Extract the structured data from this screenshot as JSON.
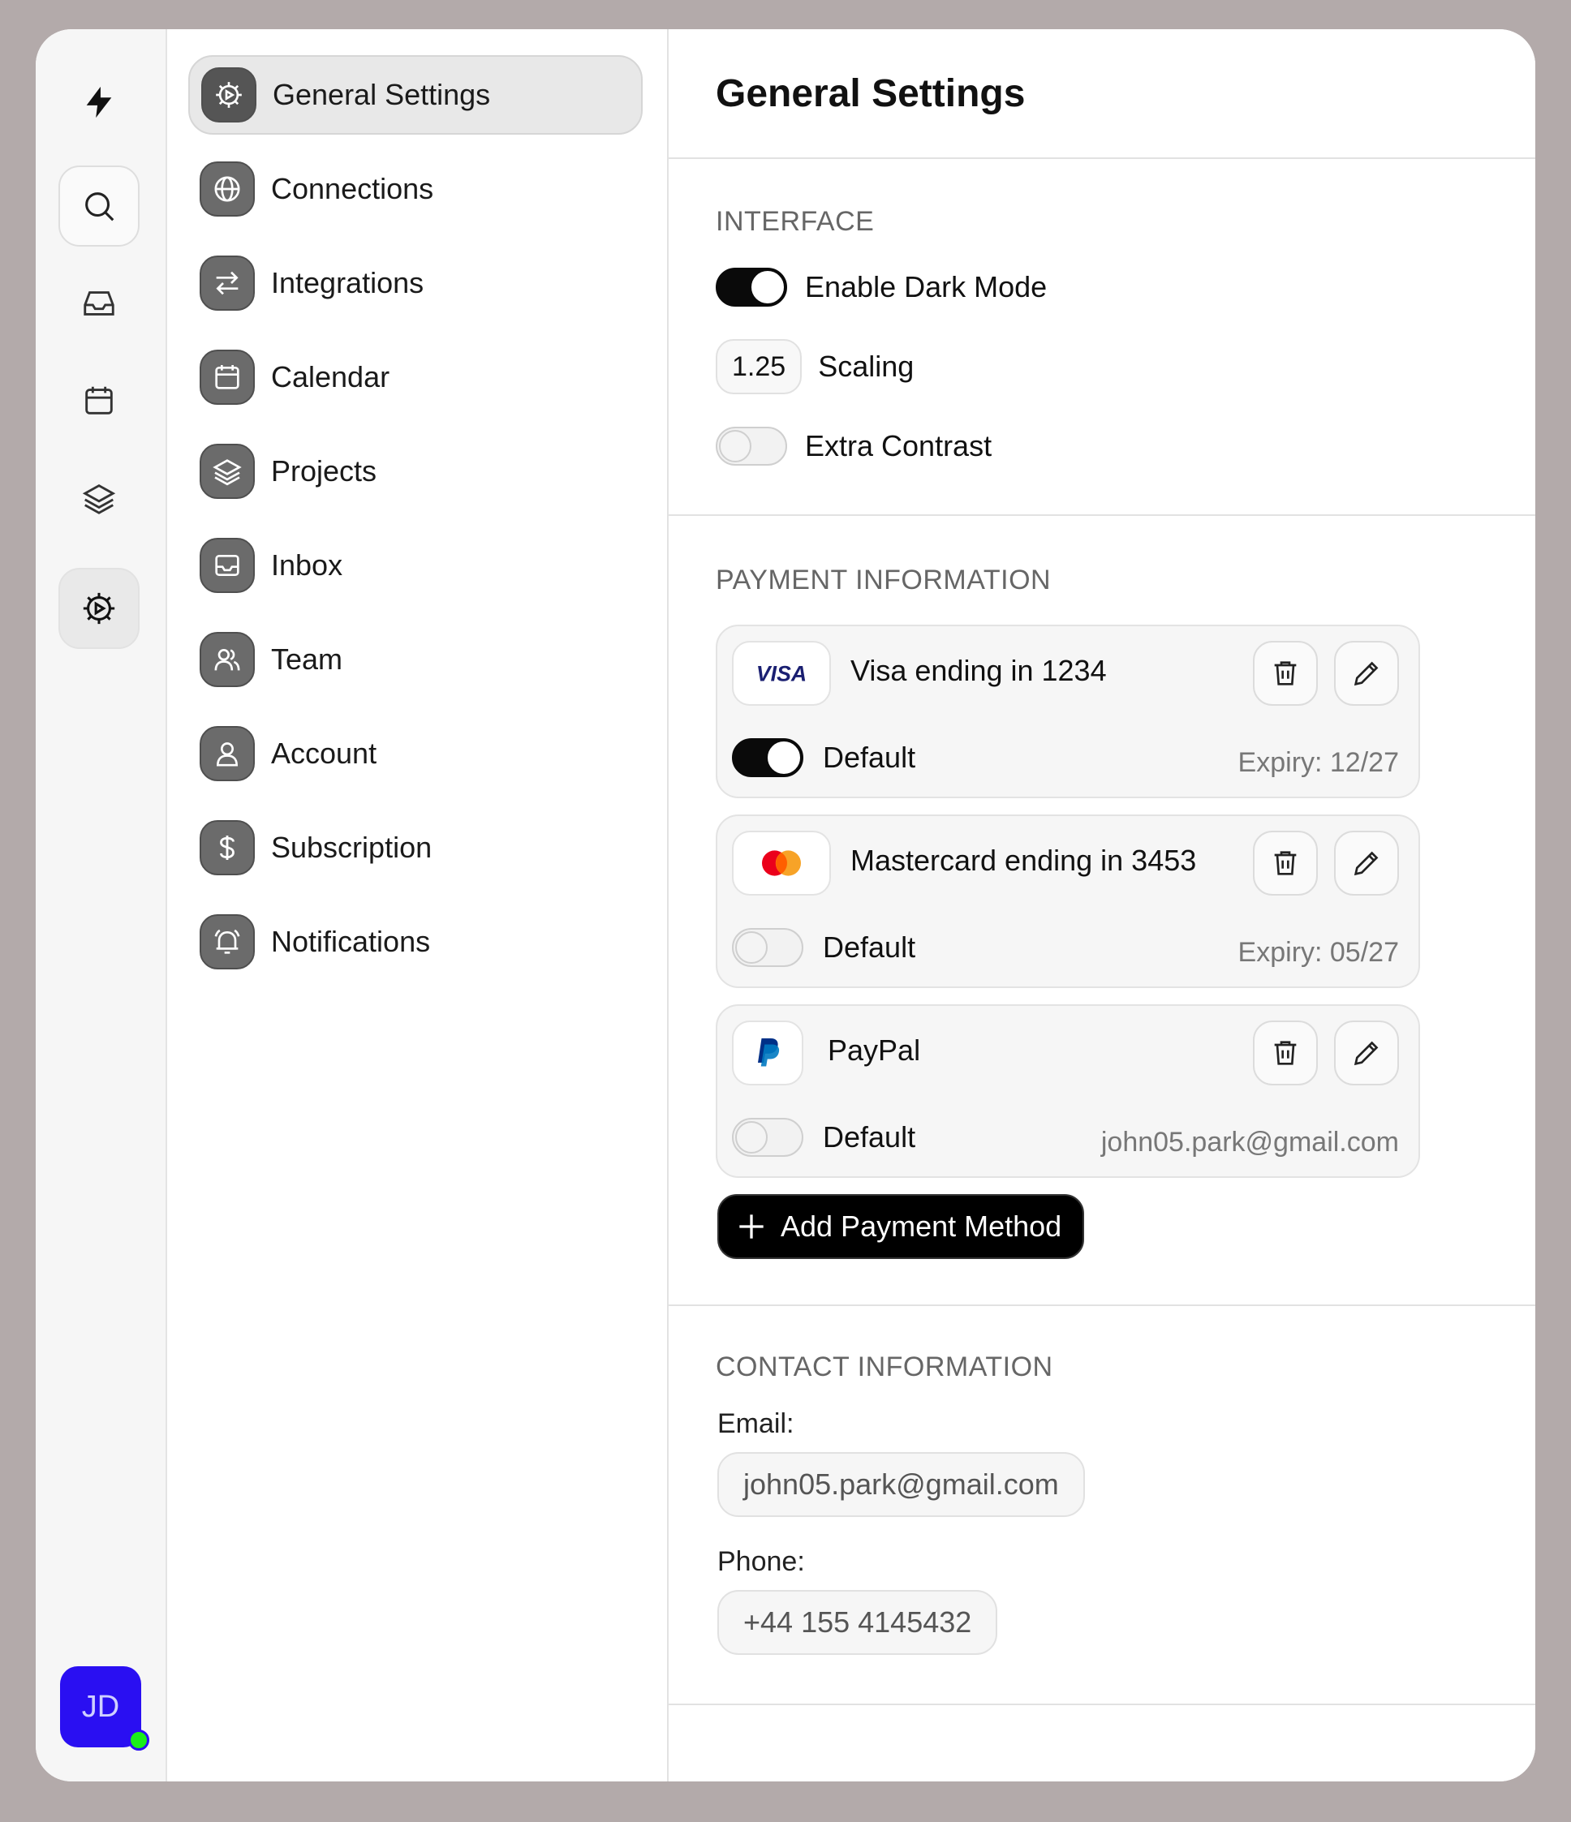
{
  "nav": {
    "items": [
      {
        "label": "General Settings",
        "icon": "gear-icon"
      },
      {
        "label": "Connections",
        "icon": "globe-icon"
      },
      {
        "label": "Integrations",
        "icon": "arrows-icon"
      },
      {
        "label": "Calendar",
        "icon": "calendar-icon"
      },
      {
        "label": "Projects",
        "icon": "layers-icon"
      },
      {
        "label": "Inbox",
        "icon": "inbox-icon"
      },
      {
        "label": "Team",
        "icon": "team-icon"
      },
      {
        "label": "Account",
        "icon": "user-icon"
      },
      {
        "label": "Subscription",
        "icon": "dollar-icon"
      },
      {
        "label": "Notifications",
        "icon": "bell-icon"
      }
    ]
  },
  "user": {
    "initials": "JD",
    "status_color": "#1aef1a",
    "avatar_color": "#2a0ff2"
  },
  "page": {
    "title": "General Settings"
  },
  "interface": {
    "label": "INTERFACE",
    "dark_mode_label": "Enable Dark Mode",
    "dark_mode_on": true,
    "scaling_value": "1.25",
    "scaling_label": "Scaling",
    "contrast_label": "Extra Contrast",
    "contrast_on": false
  },
  "payment": {
    "label": "PAYMENT INFORMATION",
    "cards": [
      {
        "brand": "VISA",
        "title": "Visa ending in 1234",
        "default_label": "Default",
        "is_default": true,
        "meta": "Expiry: 12/27"
      },
      {
        "brand": "mastercard",
        "title": "Mastercard ending in 3453",
        "default_label": "Default",
        "is_default": false,
        "meta": "Expiry: 05/27"
      },
      {
        "brand": "paypal",
        "title": "PayPal",
        "default_label": "Default",
        "is_default": false,
        "meta": "john05.park@gmail.com"
      }
    ],
    "add_label": "Add Payment Method"
  },
  "contact": {
    "label": "CONTACT INFORMATION",
    "email_label": "Email:",
    "email_value": "john05.park@gmail.com",
    "phone_label": "Phone:",
    "phone_value": "+44 155 4145432"
  }
}
